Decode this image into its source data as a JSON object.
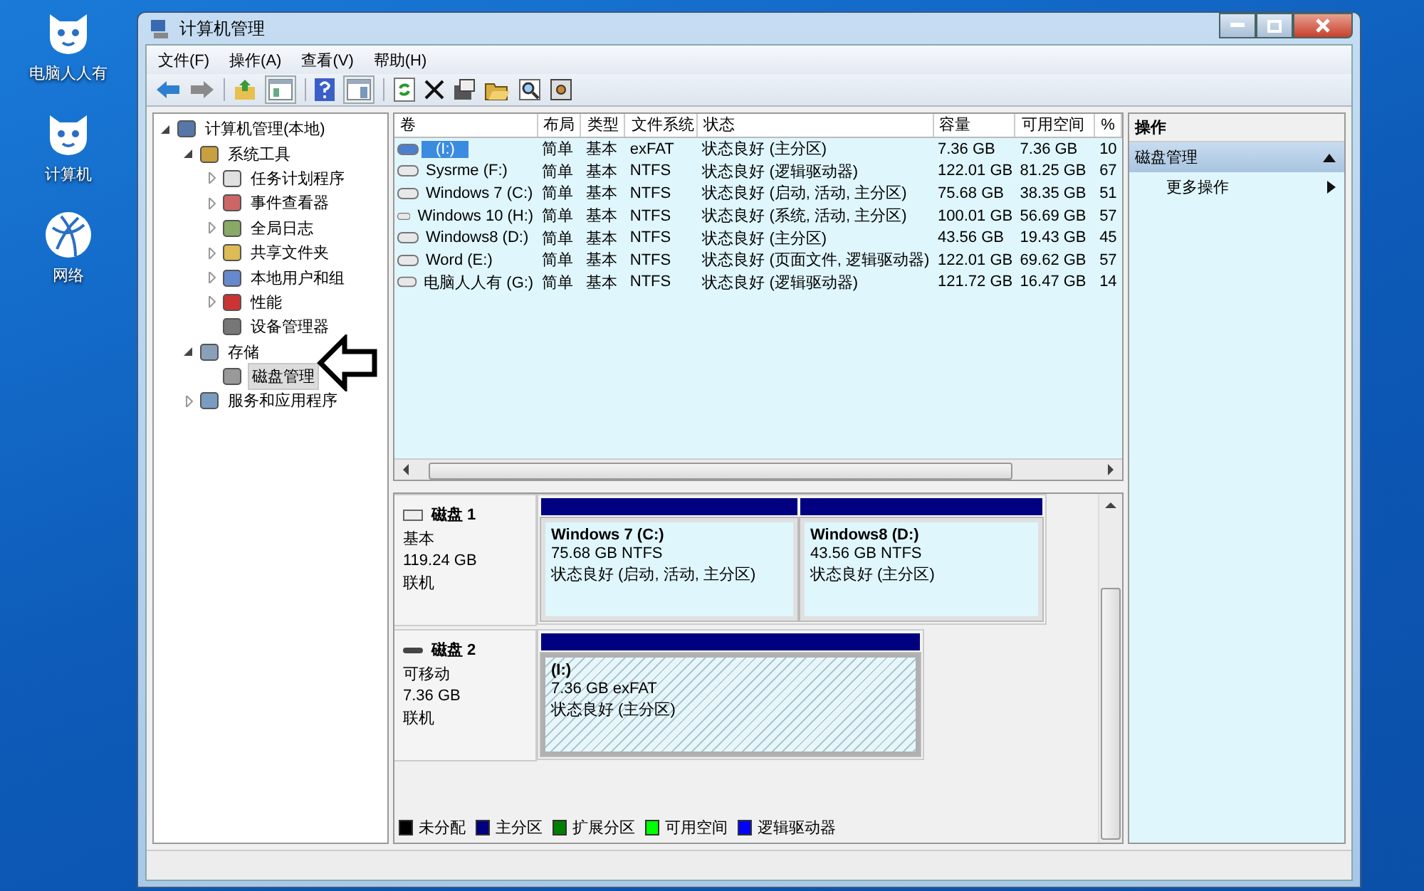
{
  "desktop_icons": [
    {
      "label": "电脑人人有",
      "kind": "tiger"
    },
    {
      "label": "计算机",
      "kind": "tiger"
    },
    {
      "label": "网络",
      "kind": "globe"
    }
  ],
  "window": {
    "title": "计算机管理"
  },
  "menu": [
    "文件(F)",
    "操作(A)",
    "查看(V)",
    "帮助(H)"
  ],
  "tree": [
    {
      "label": "计算机管理(本地)",
      "kind": "branch",
      "expanded": true,
      "selected": false,
      "children": [
        {
          "label": "系统工具",
          "kind": "branch",
          "expanded": true,
          "selected": false,
          "children": [
            {
              "label": "任务计划程序",
              "kind": "branch",
              "expanded": false,
              "selected": false
            },
            {
              "label": "事件查看器",
              "kind": "branch",
              "expanded": false,
              "selected": false
            },
            {
              "label": "全局日志",
              "kind": "branch",
              "expanded": false,
              "selected": false
            },
            {
              "label": "共享文件夹",
              "kind": "branch",
              "expanded": false,
              "selected": false
            },
            {
              "label": "本地用户和组",
              "kind": "branch",
              "expanded": false,
              "selected": false
            },
            {
              "label": "性能",
              "kind": "branch",
              "expanded": false,
              "selected": false
            },
            {
              "label": "设备管理器",
              "kind": "leaf",
              "selected": false
            }
          ]
        },
        {
          "label": "存储",
          "kind": "branch",
          "expanded": true,
          "selected": false,
          "children": [
            {
              "label": "磁盘管理",
              "kind": "leaf",
              "selected": true
            }
          ]
        },
        {
          "label": "服务和应用程序",
          "kind": "branch",
          "expanded": false,
          "selected": false
        }
      ]
    }
  ],
  "volumes": {
    "columns": [
      "卷",
      "布局",
      "类型",
      "文件系统",
      "状态",
      "容量",
      "可用空间",
      "%"
    ],
    "rows": [
      {
        "selected": true,
        "cells": [
          "(I:)",
          "简单",
          "基本",
          "exFAT",
          "状态良好 (主分区)",
          "7.36 GB",
          "7.36 GB",
          "10"
        ]
      },
      {
        "selected": false,
        "cells": [
          "Sysrme (F:)",
          "简单",
          "基本",
          "NTFS",
          "状态良好 (逻辑驱动器)",
          "122.01 GB",
          "81.25 GB",
          "67"
        ]
      },
      {
        "selected": false,
        "cells": [
          "Windows 7  (C:)",
          "简单",
          "基本",
          "NTFS",
          "状态良好 (启动, 活动, 主分区)",
          "75.68 GB",
          "38.35 GB",
          "51"
        ]
      },
      {
        "selected": false,
        "cells": [
          "Windows 10 (H:)",
          "简单",
          "基本",
          "NTFS",
          "状态良好 (系统, 活动, 主分区)",
          "100.01 GB",
          "56.69 GB",
          "57"
        ]
      },
      {
        "selected": false,
        "cells": [
          "Windows8 (D:)",
          "简单",
          "基本",
          "NTFS",
          "状态良好 (主分区)",
          "43.56 GB",
          "19.43 GB",
          "45"
        ]
      },
      {
        "selected": false,
        "cells": [
          "Word (E:)",
          "简单",
          "基本",
          "NTFS",
          "状态良好 (页面文件, 逻辑驱动器)",
          "122.01 GB",
          "69.62 GB",
          "57"
        ]
      },
      {
        "selected": false,
        "cells": [
          "电脑人人有 (G:)",
          "简单",
          "基本",
          "NTFS",
          "状态良好 (逻辑驱动器)",
          "121.72 GB",
          "16.47 GB",
          "14"
        ]
      }
    ]
  },
  "disks": [
    {
      "name": "磁盘 1",
      "type": "基本",
      "size": "119.24 GB",
      "status": "联机",
      "removable": false,
      "partitions": [
        {
          "name": "Windows 7   (C:)",
          "size": "75.68 GB NTFS",
          "status": "状态良好 (启动, 活动, 主分区)",
          "selected": false
        },
        {
          "name": "Windows8  (D:)",
          "size": "43.56 GB NTFS",
          "status": "状态良好 (主分区)",
          "selected": false
        }
      ]
    },
    {
      "name": "磁盘 2",
      "type": "可移动",
      "size": "7.36 GB",
      "status": "联机",
      "removable": true,
      "partitions": [
        {
          "name": "(I:)",
          "size": "7.36 GB exFAT",
          "status": "状态良好 (主分区)",
          "selected": true
        }
      ]
    }
  ],
  "legend": [
    {
      "label": "未分配",
      "color": "#000000"
    },
    {
      "label": "主分区",
      "color": "#000080"
    },
    {
      "label": "扩展分区",
      "color": "#008000"
    },
    {
      "label": "可用空间",
      "color": "#00ff00"
    },
    {
      "label": "逻辑驱动器",
      "color": "#0000ff"
    }
  ],
  "actions": {
    "title": "操作",
    "section": "磁盘管理",
    "expanded": true,
    "items": [
      "更多操作"
    ]
  }
}
